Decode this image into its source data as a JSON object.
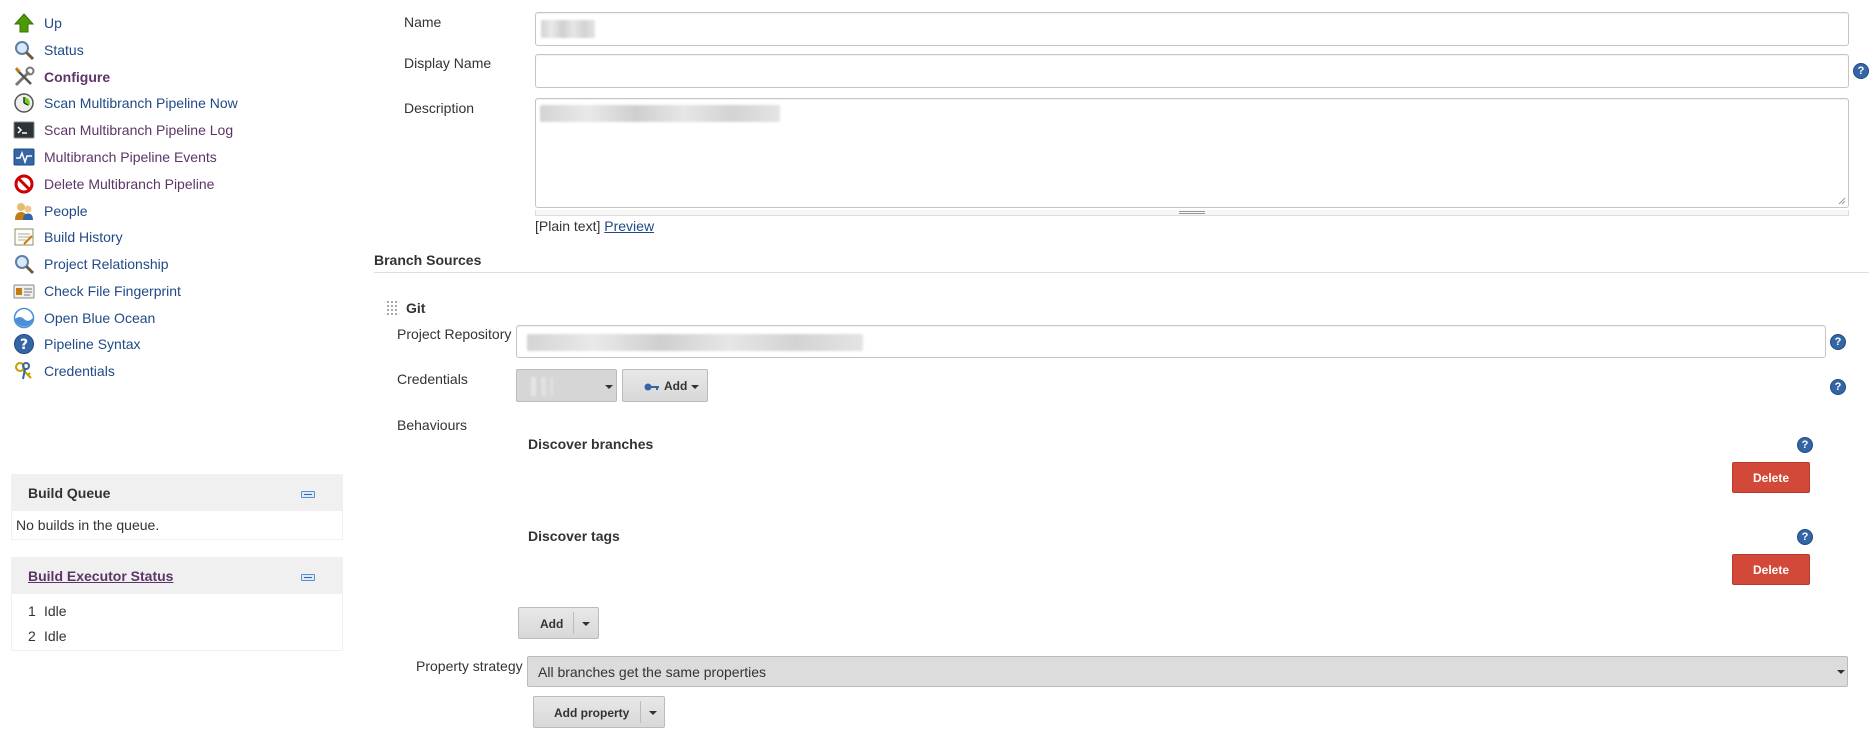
{
  "sidebar": {
    "tasks": [
      {
        "label": "Up",
        "icon": "up-arrow-icon"
      },
      {
        "label": "Status",
        "icon": "magnifier-icon"
      },
      {
        "label": "Configure",
        "icon": "tools-icon"
      },
      {
        "label": "Scan Multibranch Pipeline Now",
        "icon": "clock-icon"
      },
      {
        "label": "Scan Multibranch Pipeline Log",
        "icon": "terminal-icon"
      },
      {
        "label": "Multibranch Pipeline Events",
        "icon": "monitor-pulse-icon"
      },
      {
        "label": "Delete Multibranch Pipeline",
        "icon": "no-entry-icon"
      },
      {
        "label": "People",
        "icon": "people-icon"
      },
      {
        "label": "Build History",
        "icon": "notepad-icon"
      },
      {
        "label": "Project Relationship",
        "icon": "magnifier-icon"
      },
      {
        "label": "Check File Fingerprint",
        "icon": "id-card-icon"
      },
      {
        "label": "Open Blue Ocean",
        "icon": "blue-ocean-icon"
      },
      {
        "label": "Pipeline Syntax",
        "icon": "help-circle-icon"
      },
      {
        "label": "Credentials",
        "icon": "keys-icon"
      }
    ],
    "build_queue": {
      "title": "Build Queue",
      "empty_text": "No builds in the queue."
    },
    "executor_status": {
      "title": "Build Executor Status",
      "executors": [
        {
          "num": "1",
          "state": "Idle"
        },
        {
          "num": "2",
          "state": "Idle"
        }
      ]
    }
  },
  "form": {
    "name_label": "Name",
    "display_name_label": "Display Name",
    "description_label": "Description",
    "plain_text": "[Plain text]",
    "preview_link": "Preview",
    "branch_sources_title": "Branch Sources",
    "git": {
      "title": "Git",
      "project_repository_label": "Project Repository",
      "credentials_label": "Credentials",
      "add_credentials_label": "Add",
      "behaviours_label": "Behaviours",
      "behaviours": [
        {
          "title": "Discover branches",
          "delete_label": "Delete"
        },
        {
          "title": "Discover tags",
          "delete_label": "Delete"
        }
      ],
      "add_behaviour_label": "Add"
    },
    "property_strategy_label": "Property strategy",
    "property_strategy_value": "All branches get the same properties",
    "add_property_label": "Add property"
  },
  "colors": {
    "link": "#204a87",
    "visited": "#5c3566",
    "delete": "#d24939",
    "help": "#3465a4"
  }
}
